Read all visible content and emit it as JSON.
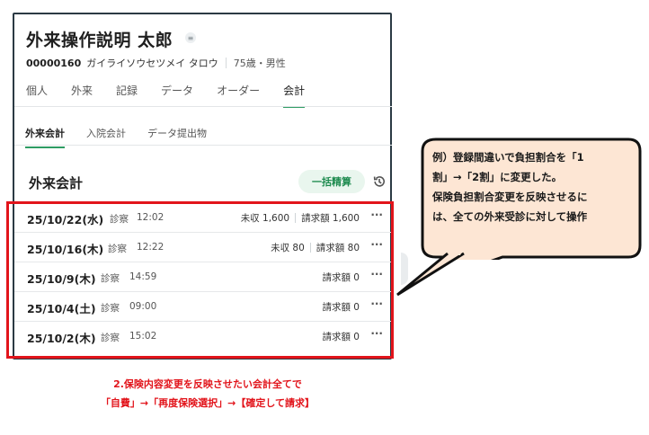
{
  "patient": {
    "name": "外来操作説明 太郎",
    "id": "00000160",
    "kana": "ガイライソウセツメイ タロウ",
    "age_sex": "75歳・男性",
    "memo_icon": "note-icon"
  },
  "main_tabs": [
    "個人",
    "外来",
    "記録",
    "データ",
    "オーダー",
    "会計"
  ],
  "sub_tabs": [
    "外来会計",
    "入院会計",
    "データ提出物"
  ],
  "section": {
    "title": "外来会計",
    "bulk_button": "一括精算",
    "history_icon": "history-icon"
  },
  "visits": [
    {
      "date": "25/10/22(水)",
      "type": "診察",
      "time": "12:02",
      "unpaid": "未収 1,600",
      "billed": "請求額 1,600",
      "more": "···"
    },
    {
      "date": "25/10/16(木)",
      "type": "診察",
      "time": "12:22",
      "unpaid": "未収 80",
      "billed": "請求額 80",
      "more": "···"
    },
    {
      "date": "25/10/9(木)",
      "type": "診察",
      "time": "14:59",
      "unpaid": "",
      "billed": "請求額 0",
      "more": "···"
    },
    {
      "date": "25/10/4(土)",
      "type": "診察",
      "time": "09:00",
      "unpaid": "",
      "billed": "請求額 0",
      "more": "···"
    },
    {
      "date": "25/10/2(木)",
      "type": "診察",
      "time": "15:02",
      "unpaid": "",
      "billed": "請求額 0",
      "more": "···"
    }
  ],
  "callout": {
    "line1": "例）登録間違いで負担割合を「1",
    "line2": "割」→「2割」に変更した。",
    "line3": "保険負担割合変更を反映させるに",
    "line4": "は、全ての外来受診に対して操作"
  },
  "instruction": {
    "line1": "2.保険内容変更を反映させたい会計全てで",
    "line2": "「自費」→「再度保険選択」→【確定して請求】"
  },
  "colors": {
    "accent_green": "#2e9c63",
    "annotation_red": "#e2141b",
    "callout_fill": "#fde6d4"
  }
}
